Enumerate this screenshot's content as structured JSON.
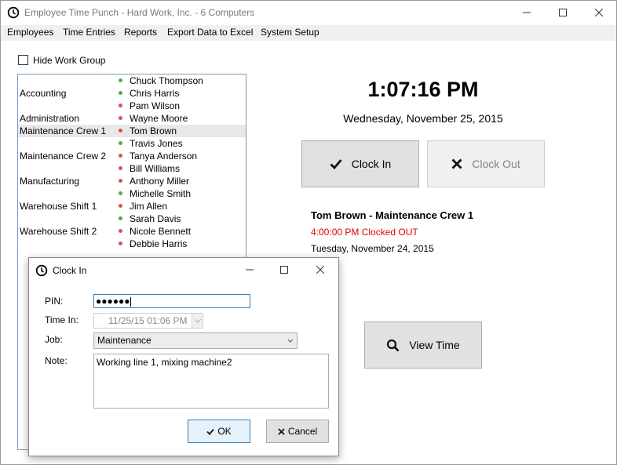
{
  "window": {
    "title": "Employee Time Punch - Hard Work, Inc. - 6 Computers",
    "icon": "clock-icon"
  },
  "menu": [
    "Employees",
    "Time Entries",
    "Reports",
    "Export Data to Excel",
    "System Setup"
  ],
  "hide_group_label": "Hide Work Group",
  "groups": [
    "Accounting",
    "Administration",
    "Maintenance Crew 1",
    "Maintenance Crew 2",
    "Manufacturing",
    "Warehouse Shift 1",
    "Warehouse Shift 2"
  ],
  "employees": [
    {
      "name": "Chuck Thompson",
      "status": "in"
    },
    {
      "name": "Chris Harris",
      "status": "in"
    },
    {
      "name": "Pam Wilson",
      "status": "out"
    },
    {
      "name": "Wayne Moore",
      "status": "out"
    },
    {
      "name": "Tom Brown",
      "status": "out"
    },
    {
      "name": "Travis Jones",
      "status": "in"
    },
    {
      "name": "Tanya Anderson",
      "status": "out"
    },
    {
      "name": "Bill Williams",
      "status": "out"
    },
    {
      "name": "Anthony Miller",
      "status": "out"
    },
    {
      "name": "Michelle Smith",
      "status": "in"
    },
    {
      "name": "Jim Allen",
      "status": "out"
    },
    {
      "name": "Sarah Davis",
      "status": "in"
    },
    {
      "name": "Nicole Bennett",
      "status": "out"
    },
    {
      "name": "Debbie Harris",
      "status": "out"
    }
  ],
  "colors": {
    "in": "#4cae4c",
    "out": "#e05050",
    "clocked_out": "#e00000"
  },
  "clock": {
    "time": "1:07:16 PM",
    "date": "Wednesday, November 25, 2015"
  },
  "buttons": {
    "clock_in": "Clock In",
    "clock_out": "Clock Out",
    "view_time": "View Time"
  },
  "status": {
    "name": "Tom Brown - Maintenance Crew 1",
    "line": "4:00:00 PM Clocked OUT",
    "date": "Tuesday, November 24, 2015"
  },
  "dialog": {
    "title": "Clock In",
    "pin_label": "PIN:",
    "pin_value": "●●●●●●",
    "time_label": "Time In:",
    "time_value": "11/25/15 01:06 PM",
    "job_label": "Job:",
    "job_value": "Maintenance",
    "note_label": "Note:",
    "note_value": "Working line 1, mixing machine2",
    "ok": "OK",
    "cancel": "Cancel"
  }
}
